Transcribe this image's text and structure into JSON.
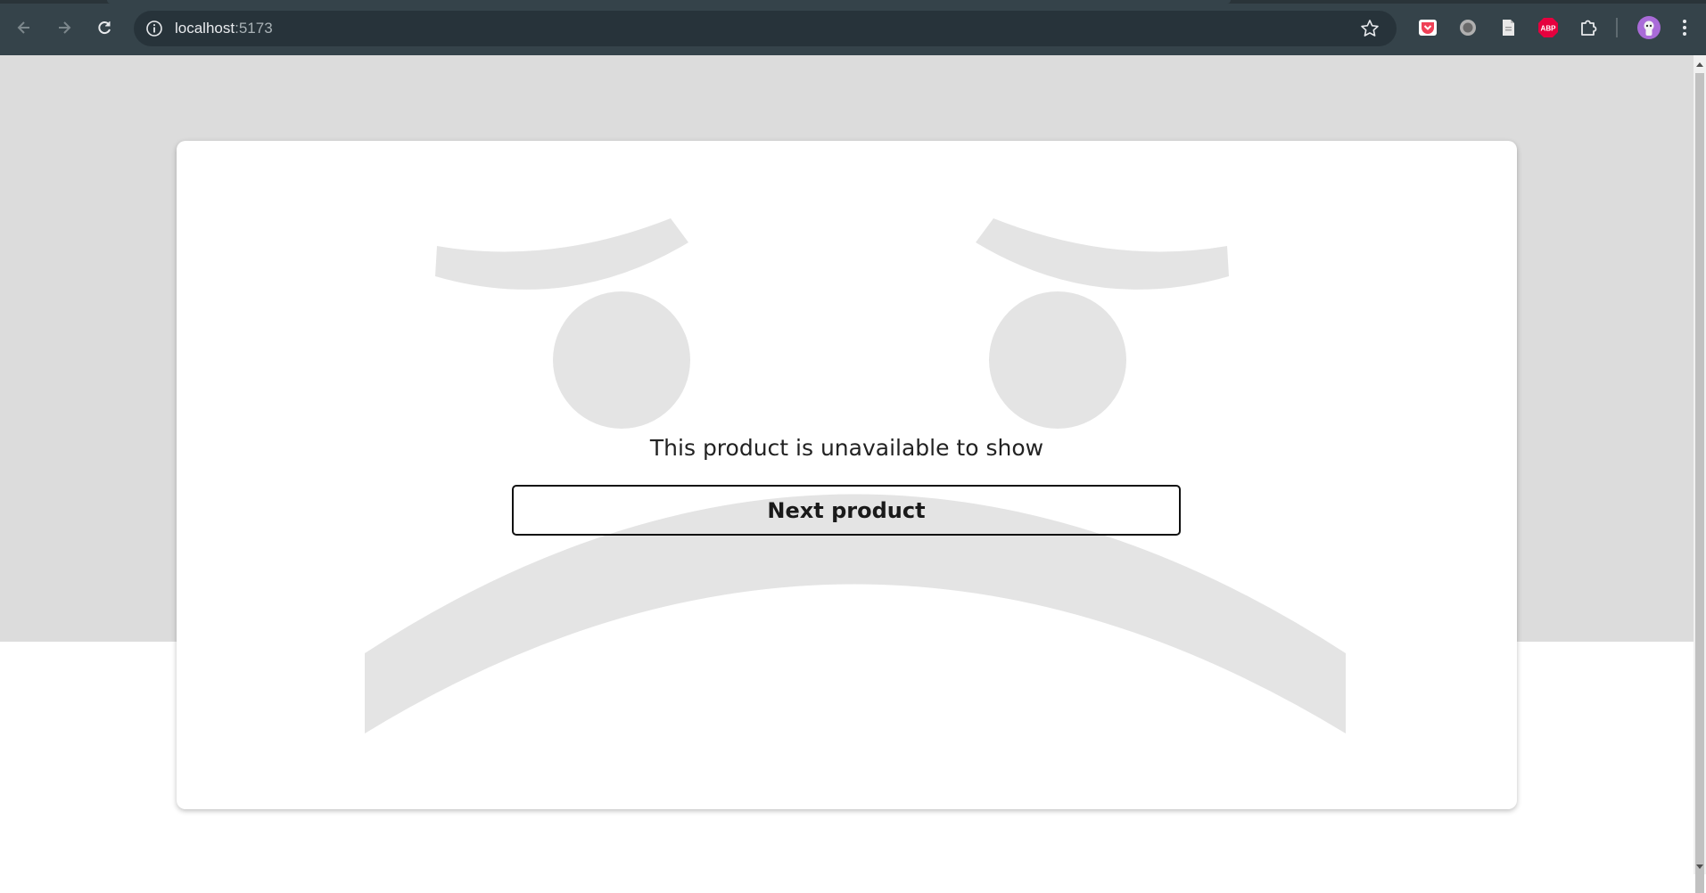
{
  "browser": {
    "url_host": "localhost",
    "url_port": ":5173",
    "nav": {
      "back_icon": "arrow-left-icon",
      "forward_icon": "arrow-right-icon",
      "reload_icon": "reload-icon"
    },
    "extensions": [
      {
        "name": "pocket-extension-icon",
        "color": "#ef4056"
      },
      {
        "name": "circle-extension-icon",
        "color": "#9e9e9e"
      },
      {
        "name": "document-extension-icon",
        "color": "#e0e0e0"
      },
      {
        "name": "adblock-plus-extension-icon",
        "color": "#e6003e",
        "label": "ABP"
      },
      {
        "name": "puzzle-extensions-icon",
        "color": "#e8eaed"
      }
    ],
    "profile_color": "#a96bd8"
  },
  "content": {
    "message": "This product is unavailable to show",
    "next_button_label": "Next product"
  },
  "colors": {
    "page_background": "#dcdcdc",
    "face_color": "#e4e4e4",
    "card_background": "#ffffff"
  }
}
